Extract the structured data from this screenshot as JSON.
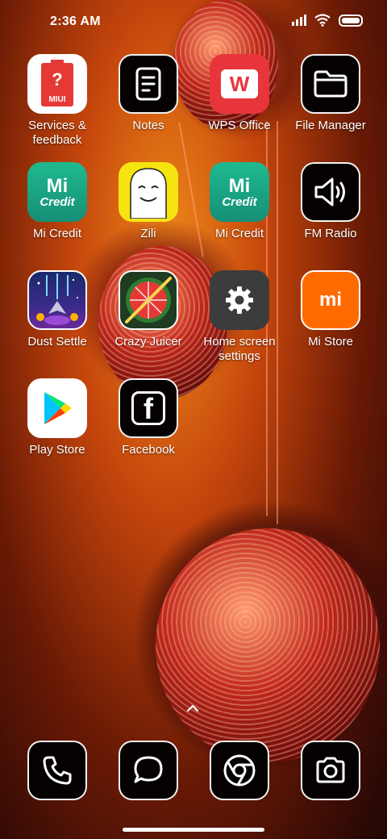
{
  "status_bar": {
    "time": "2:36 AM",
    "icons": [
      "signal-icon",
      "wifi-icon",
      "battery-icon"
    ]
  },
  "apps": [
    {
      "label": "Services & feedback",
      "icon": "services-feedback-icon",
      "badge": "MIUI"
    },
    {
      "label": "Notes",
      "icon": "notes-icon"
    },
    {
      "label": "WPS Office",
      "icon": "wps-office-icon",
      "mark": "W"
    },
    {
      "label": "File Manager",
      "icon": "folder-icon"
    },
    {
      "label": "Mi Credit",
      "icon": "mi-credit-icon",
      "mark": "Mi",
      "sub": "Credit"
    },
    {
      "label": "Zili",
      "icon": "zili-icon"
    },
    {
      "label": "Mi Credit",
      "icon": "mi-credit-icon",
      "mark": "Mi",
      "sub": "Credit"
    },
    {
      "label": "FM Radio",
      "icon": "speaker-icon"
    },
    {
      "label": "Dust Settle",
      "icon": "dust-settle-icon"
    },
    {
      "label": "Crazy Juicer",
      "icon": "crazy-juicer-icon"
    },
    {
      "label": "Home screen settings",
      "icon": "gear-icon"
    },
    {
      "label": "Mi Store",
      "icon": "mi-store-icon",
      "mark": "mi"
    },
    {
      "label": "Play Store",
      "icon": "play-store-icon"
    },
    {
      "label": "Facebook",
      "icon": "facebook-icon",
      "mark": "f"
    }
  ],
  "dock": [
    {
      "name": "phone",
      "icon": "phone-icon"
    },
    {
      "name": "messaging",
      "icon": "message-icon"
    },
    {
      "name": "browser",
      "icon": "browser-icon"
    },
    {
      "name": "camera",
      "icon": "camera-icon"
    }
  ],
  "colors": {
    "wps_red": "#e8353c",
    "mi_credit_teal": "#1fa98a",
    "zili_yellow": "#f5e410",
    "mi_store_orange": "#ff6a00",
    "gear_gray": "#3c3c3c"
  }
}
